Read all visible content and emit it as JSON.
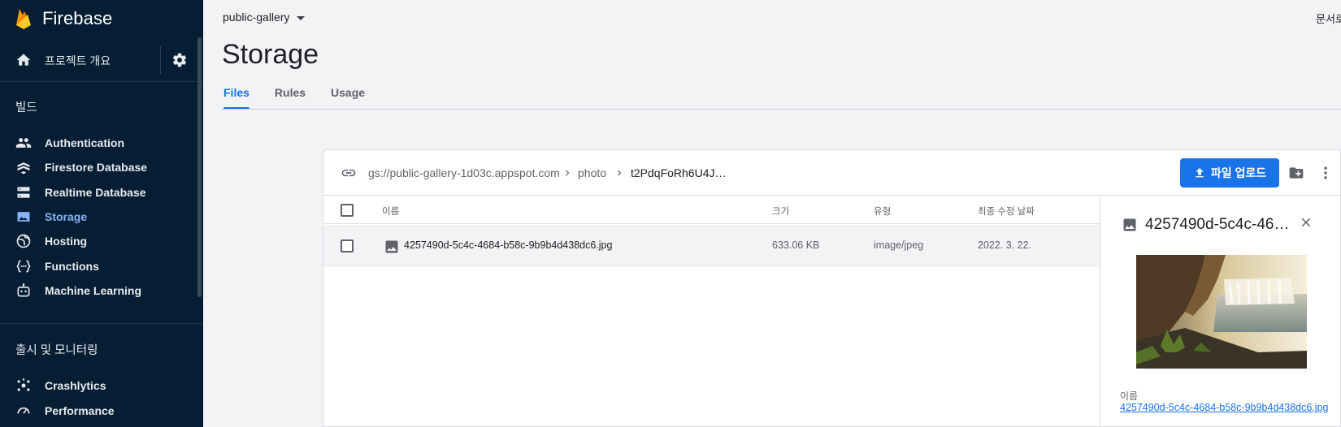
{
  "sidebar": {
    "brand": "Firebase",
    "overview_label": "프로젝트 개요",
    "build_section": "빌드",
    "build_items": [
      {
        "label": "Authentication",
        "icon": "users-icon"
      },
      {
        "label": "Firestore Database",
        "icon": "firestore-icon"
      },
      {
        "label": "Realtime Database",
        "icon": "database-icon"
      },
      {
        "label": "Storage",
        "icon": "storage-image-icon",
        "active": true
      },
      {
        "label": "Hosting",
        "icon": "globe-icon"
      },
      {
        "label": "Functions",
        "icon": "functions-icon"
      },
      {
        "label": "Machine Learning",
        "icon": "robot-icon"
      }
    ],
    "release_section": "출시 및 모니터링",
    "release_items": [
      {
        "label": "Crashlytics",
        "icon": "crashlytics-icon"
      },
      {
        "label": "Performance",
        "icon": "performance-icon"
      }
    ]
  },
  "header": {
    "project": "public-gallery",
    "top_right": "문서로 이동",
    "title": "Storage",
    "tabs": [
      "Files",
      "Rules",
      "Usage"
    ],
    "active_tab": "Files"
  },
  "storage": {
    "breadcrumb": [
      "gs://public-gallery-1d03c.appspot.com",
      "photo",
      "t2PdqFoRh6U4J…"
    ],
    "upload_label": "파일 업로드",
    "columns": {
      "name": "이름",
      "size": "크기",
      "type": "유형",
      "modified": "최종 수정 날짜"
    },
    "files": [
      {
        "name": "4257490d-5c4c-4684-b58c-9b9b4d438dc6.jpg",
        "size": "633.06 KB",
        "type": "image/jpeg",
        "modified": "2022. 3. 22."
      }
    ]
  },
  "detail": {
    "title": "4257490d-5c4c-46…",
    "name_label": "이름",
    "name_value": "4257490d-5c4c-4684-b58c-9b9b4d438dc6.jpg"
  },
  "colors": {
    "sidebar_bg": "#051e34",
    "accent": "#1a73e8",
    "active_nav": "#8ab4f8",
    "page_bg": "#f1f3f4"
  }
}
